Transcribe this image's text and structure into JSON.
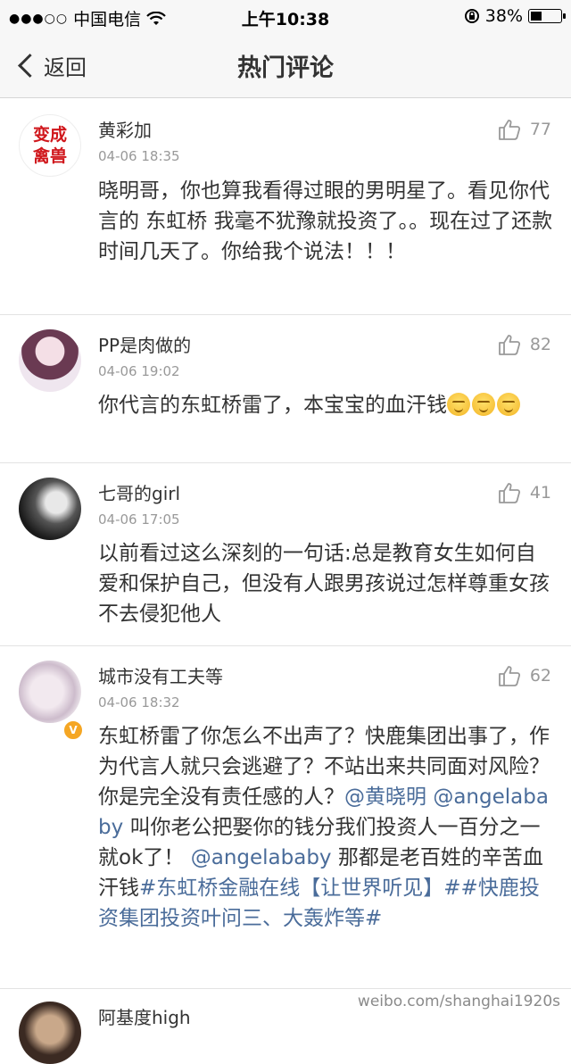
{
  "status_bar": {
    "carrier": "中国电信",
    "signal_dots": "●●●○○",
    "time": "上午10:38",
    "battery": "38%",
    "battery_level": 0.38
  },
  "nav": {
    "back_label": "返回",
    "title": "热门评论"
  },
  "comments": [
    {
      "username": "黄彩加",
      "time": "04-06 18:35",
      "likes": "77",
      "avatar_text": "变成禽兽",
      "text": "晓明哥，你也算我看得过眼的男明星了。看见你代言的 东虹桥 我毫不犹豫就投资了。。现在过了还款时间几天了。你给我个说法！！！"
    },
    {
      "username": "PP是肉做的",
      "time": "04-06 19:02",
      "likes": "82",
      "text": "你代言的东虹桥雷了，本宝宝的血汗钱"
    },
    {
      "username": "七哥的girl",
      "time": "04-06 17:05",
      "likes": "41",
      "text": "以前看过这么深刻的一句话:总是教育女生如何自爱和保护自己，但没有人跟男孩说过怎样尊重女孩不去侵犯他人"
    },
    {
      "username": "城市没有工夫等",
      "time": "04-06 18:32",
      "likes": "62",
      "verified_badge": "V",
      "text_part1": "东虹桥雷了你怎么不出声了？快鹿集团出事了，作为代言人就只会逃避了？不站出来共同面对风险？你是完全没有责任感的人？",
      "mention1": "@黄晓明",
      "mention2": "@angelababy",
      "text_part2": " 叫你老公把娶你的钱分我们投资人一百分之一就ok了！",
      "mention3": "@angelababy",
      "text_part3": " 那都是老百姓的辛苦血汗钱",
      "tag1": "#东虹桥金融在线【让世界听见】#",
      "tag2": "#快鹿投资集团投资叶问三、大轰炸等#"
    },
    {
      "username": "阿基度high"
    }
  ],
  "watermark": "weibo.com/shanghai1920s",
  "colors": {
    "link": "#4a6c9a",
    "bar_bg": "#f7f7f7",
    "badge": "#f5a623"
  }
}
